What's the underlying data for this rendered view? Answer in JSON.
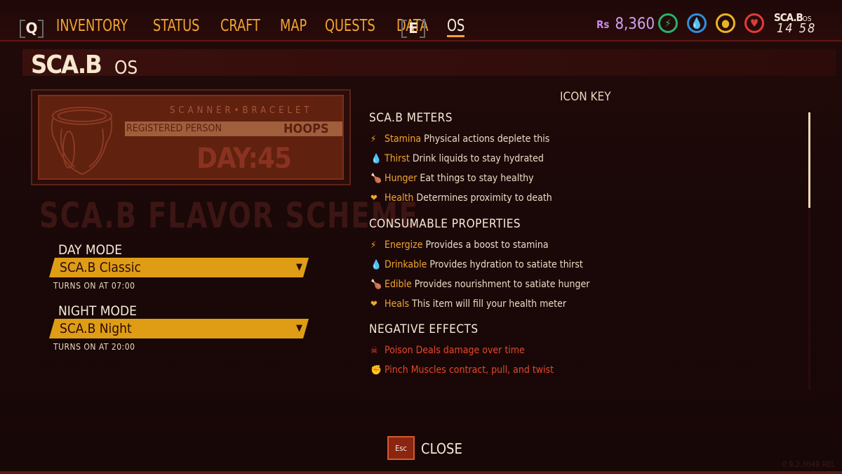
{
  "nav": {
    "left_key": "Q",
    "right_key": "E",
    "items": [
      "INVENTORY",
      "STATUS",
      "CRAFT",
      "MAP",
      "QUESTS",
      "DATA",
      "OS"
    ],
    "active": "OS"
  },
  "hud": {
    "currency_symbol": "Rs",
    "currency": "8,360",
    "meter_colors": [
      "#27b36a",
      "#2f8de0",
      "#e8b522",
      "#e03b3b"
    ],
    "meters": [
      "stamina-icon",
      "thirst-icon",
      "hunger-icon",
      "health-icon"
    ],
    "logo": "SCA.B",
    "logo_os": "OS",
    "time": "14  58"
  },
  "header": {
    "logo": "SCA.B",
    "os": "OS"
  },
  "card": {
    "title": "SCANNER•BRACELET",
    "registered_label": "REGISTERED PERSON",
    "registered_value": "HOOPS",
    "day": "DAY:45"
  },
  "flavor_title": "SCA.B FLAVOR SCHEME",
  "day_mode": {
    "label": "DAY MODE",
    "value": "SCA.B Classic",
    "turns": "TURNS ON AT 07:00"
  },
  "night_mode": {
    "label": "NIGHT MODE",
    "value": "SCA.B Night",
    "turns": "TURNS ON AT 20:00"
  },
  "icon_key": {
    "title": "ICON KEY",
    "sections": [
      {
        "title": "SCA.B METERS",
        "rows": [
          {
            "icon": "⚡",
            "name": "Stamina",
            "desc": "Physical actions deplete this"
          },
          {
            "icon": "💧",
            "name": "Thirst",
            "desc": "Drink liquids to stay hydrated"
          },
          {
            "icon": "🍗",
            "name": "Hunger",
            "desc": "Eat things to stay healthy"
          },
          {
            "icon": "❤",
            "name": "Health",
            "desc": "Determines proximity to death"
          }
        ]
      },
      {
        "title": "CONSUMABLE PROPERTIES",
        "rows": [
          {
            "icon": "⚡",
            "name": "Energize",
            "desc": "Provides a boost to stamina"
          },
          {
            "icon": "💧",
            "name": "Drinkable",
            "desc": "Provides hydration to satiate thirst"
          },
          {
            "icon": "🍗",
            "name": "Edible",
            "desc": "Provides nourishment to satiate hunger"
          },
          {
            "icon": "❤",
            "name": "Heals",
            "desc": "This item will fill your health meter"
          }
        ]
      },
      {
        "title": "NEGATIVE EFFECTS",
        "rows": [
          {
            "icon": "☠",
            "name": "Poison",
            "desc": "Deals damage over time"
          },
          {
            "icon": "✊",
            "name": "Pinch",
            "desc": "Muscles contract, pull, and twist"
          }
        ]
      }
    ]
  },
  "close": {
    "key": "Esc",
    "label": "CLOSE"
  },
  "version": "0.9.2.3049 REL"
}
